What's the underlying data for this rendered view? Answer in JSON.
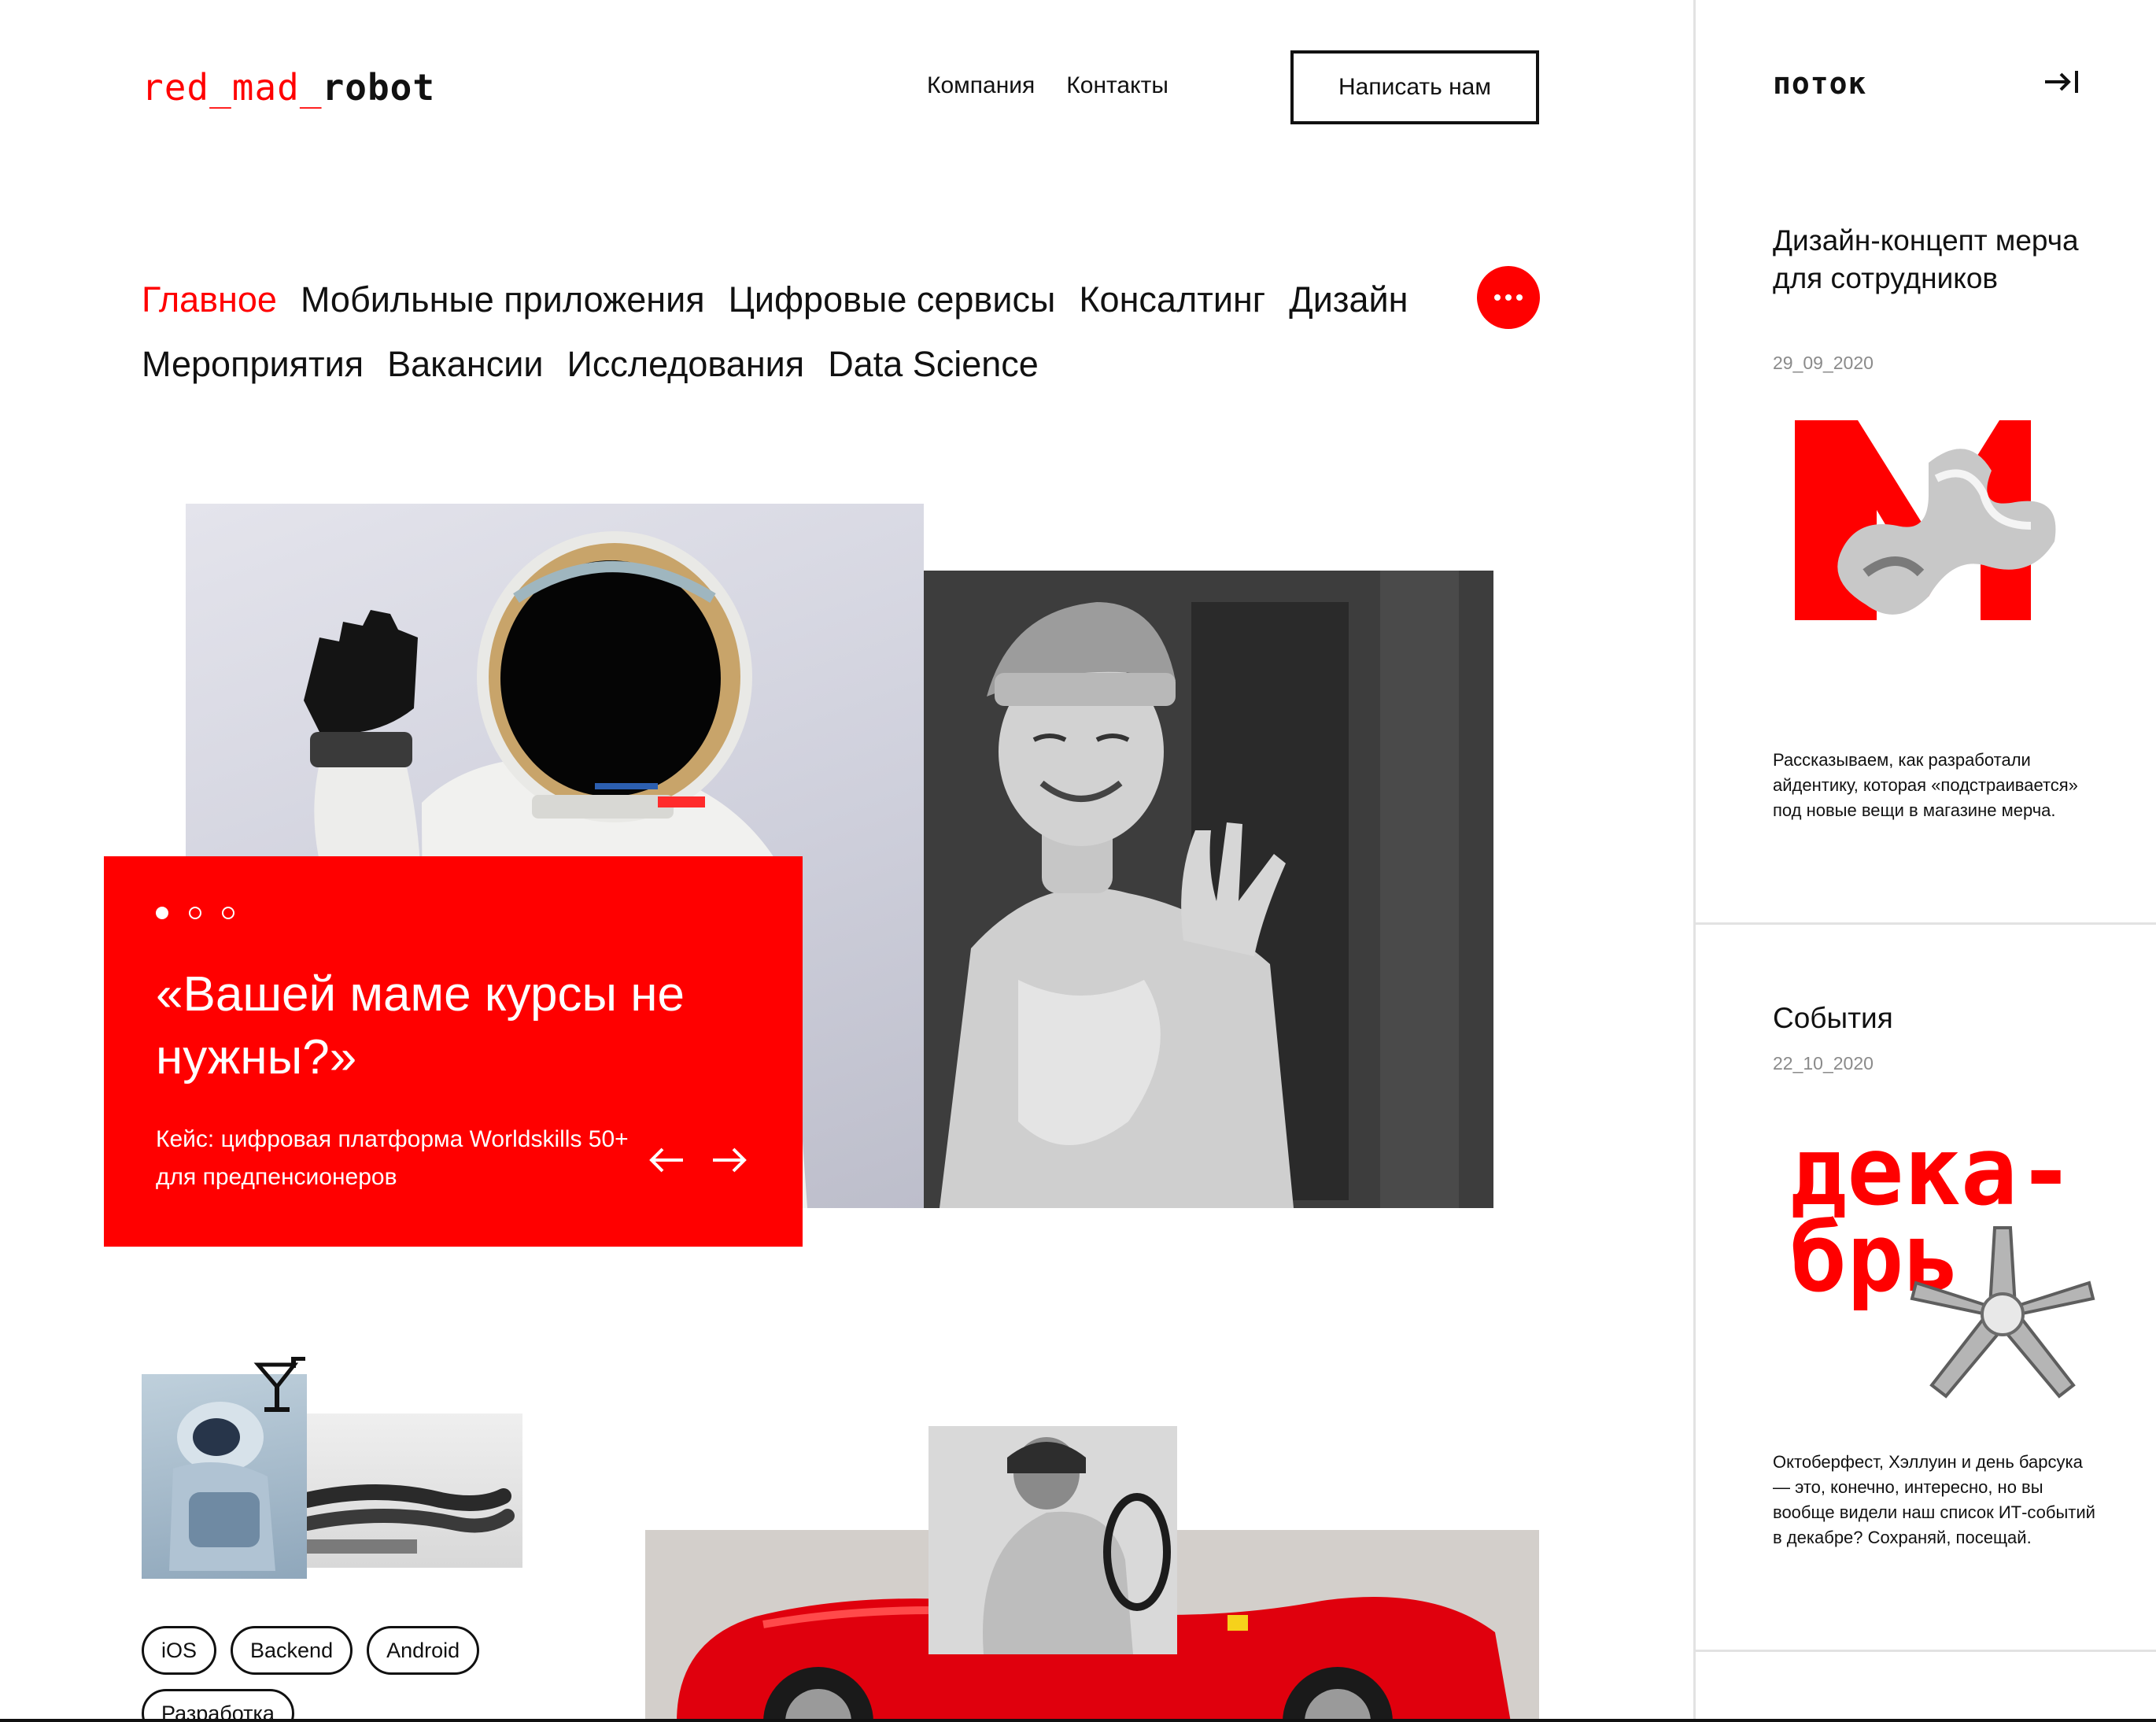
{
  "header": {
    "logo": {
      "part1": "red_mad_",
      "part2": "robot"
    },
    "nav": [
      "Компания",
      "Контакты"
    ],
    "cta_label": "Написать нам"
  },
  "categories": [
    {
      "label": "Главное",
      "active": true
    },
    {
      "label": "Мобильные приложения"
    },
    {
      "label": "Цифровые сервисы"
    },
    {
      "label": "Консалтинг"
    },
    {
      "label": "Дизайн"
    },
    {
      "label": "Мероприятия"
    },
    {
      "label": "Вакансии"
    },
    {
      "label": "Исследования"
    },
    {
      "label": "Data Science"
    }
  ],
  "hero": {
    "title": "«Вашей маме курсы не нужны?»",
    "subtitle": "Кейс: цифровая платформа Worldskills 50+ для предпенсионеров",
    "slides_total": 3,
    "slide_active": 1
  },
  "tags": [
    "iOS",
    "Backend",
    "Android",
    "Разработка"
  ],
  "feed": {
    "title": "поток",
    "posts": [
      {
        "title": "Дизайн-концепт мерча для сотрудников",
        "date": "29_09_2020",
        "text": "Рассказываем, как разработали айдентику, которая «подстраивается» под новые вещи в магазине мерча."
      },
      {
        "title": "События",
        "date": "22_10_2020",
        "image_text": [
          "дека-",
          "брь"
        ],
        "text": "Октоберфест, Хэллуин и день барсука — это, конечно, интересно, но вы вообще видели наш список ИТ-событий в декабре? Сохраняй, посещай."
      }
    ]
  },
  "colors": {
    "accent": "#ff0000",
    "text": "#111111",
    "muted": "#8a8a8a",
    "divider": "#e2e2e2"
  }
}
